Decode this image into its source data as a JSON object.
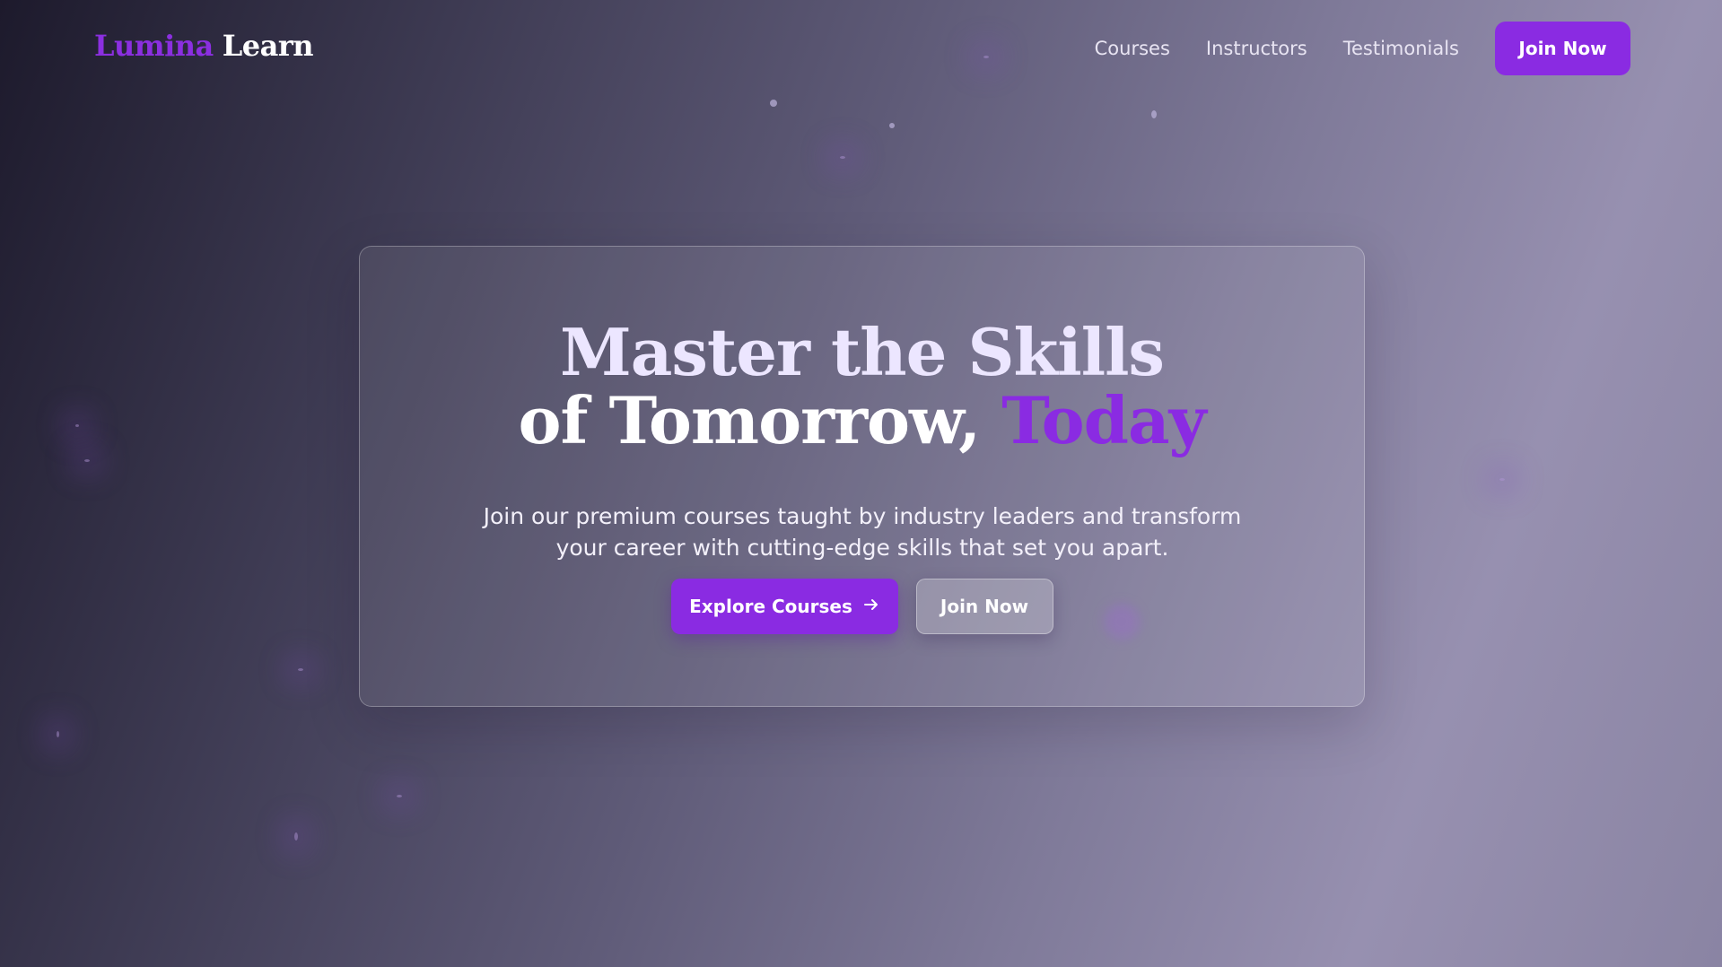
{
  "brand": {
    "part1": "Lumina",
    "part2": "Learn"
  },
  "nav": {
    "links": [
      "Courses",
      "Instructors",
      "Testimonials"
    ],
    "join_label": "Join Now"
  },
  "hero": {
    "headline_line1": "Master the Skills",
    "headline_line2_prefix": "of Tomorrow, ",
    "headline_accent": "Today",
    "subtitle": "Join our premium courses taught by industry leaders and transform your career with cutting-edge skills that set you apart.",
    "primary_button": "Explore Courses",
    "secondary_button": "Join Now"
  },
  "colors": {
    "accent": "#8a2be2",
    "text": "#ffffff"
  },
  "icons": {
    "primary_button_icon": "arrow-right-icon"
  }
}
